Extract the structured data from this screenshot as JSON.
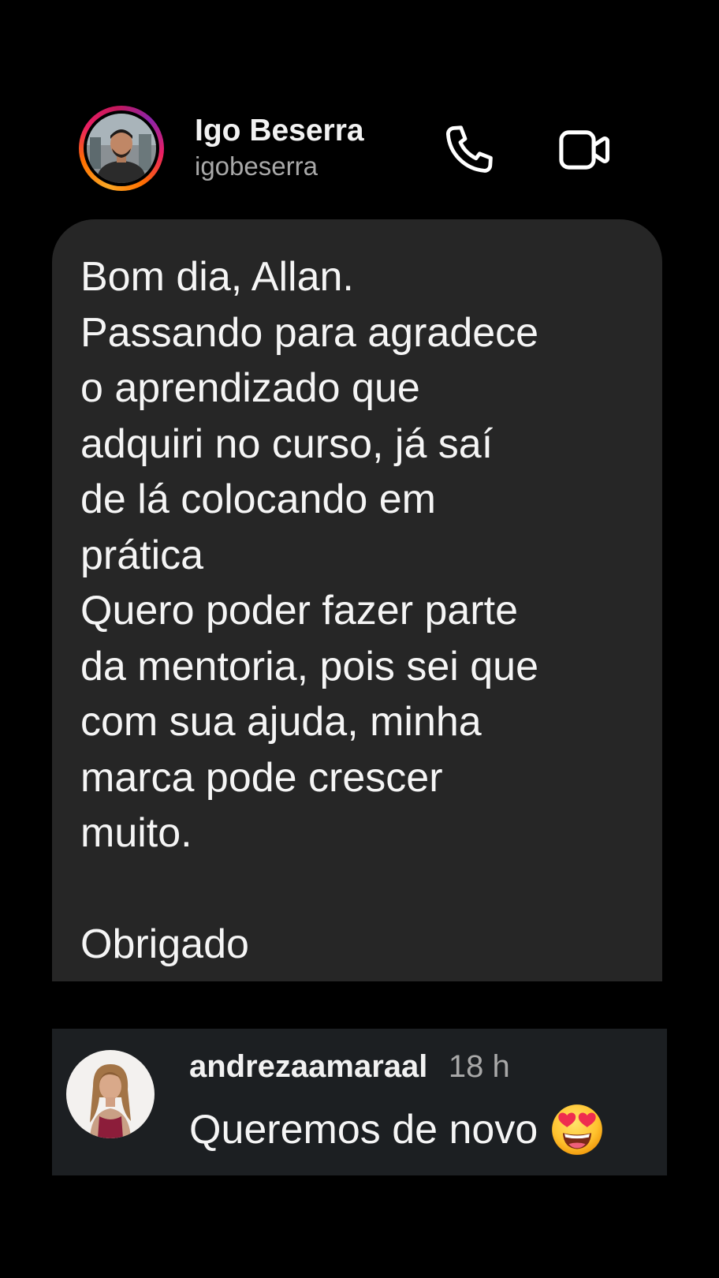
{
  "header": {
    "display_name": "Igo Beserra",
    "username": "igobeserra",
    "avatar_icon": "profile-photo",
    "story_ring_colors": [
      "#f9a825",
      "#e91e63",
      "#8e24aa"
    ],
    "call_icon": "phone-icon",
    "video_icon": "video-camera-icon"
  },
  "message": {
    "text": "Bom dia, Allan.\nPassando para agradece\no aprendizado que\nadquiri no curso, já saí\nde lá colocando em\nprática\nQuero poder fazer parte\nda mentoria, pois sei que\ncom sua ajuda, minha\nmarca pode crescer\nmuito.\n\nObrigado",
    "bubble_color": "#262626"
  },
  "comment": {
    "username": "andrezaamaraal",
    "time": "18 h",
    "text": "Queremos de novo",
    "emoji_icon": "heart-eyes-emoji",
    "card_color": "#1c1f22"
  }
}
